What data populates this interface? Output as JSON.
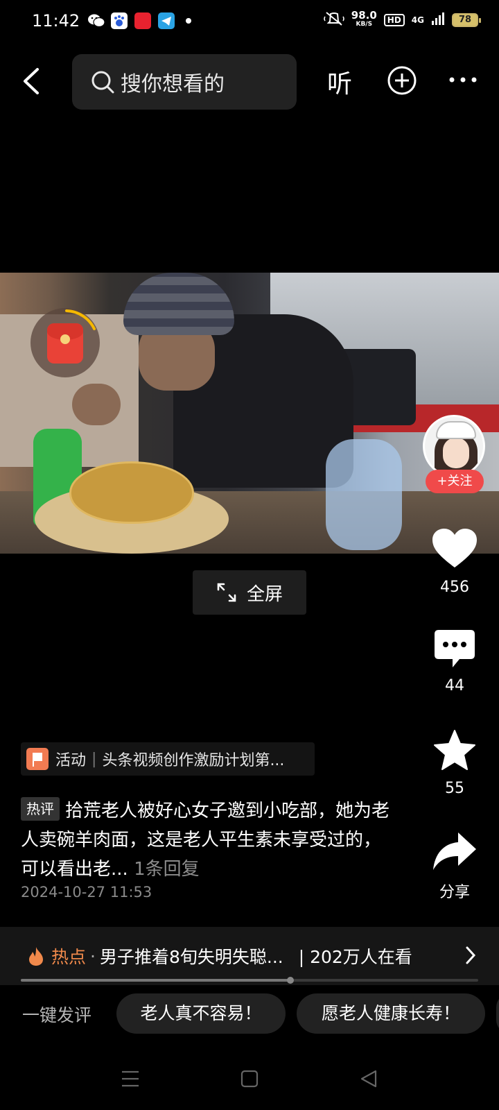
{
  "status_bar": {
    "time": "11:42",
    "app_icons": [
      "wechat-icon",
      "baidu-icon",
      "toutiao-icon",
      "telegram-icon"
    ],
    "net_speed": "98.0",
    "net_unit": "KB/S",
    "hd_label": "HD",
    "network_label": "4G",
    "battery": "78"
  },
  "top_nav": {
    "search_placeholder": "搜你想看的",
    "listen_label": "听"
  },
  "video": {
    "fullscreen_label": "全屏"
  },
  "author": {
    "follow_label": "+关注"
  },
  "actions": {
    "like_count": "456",
    "comment_count": "44",
    "favorite_count": "55",
    "share_label": "分享"
  },
  "activity": {
    "label": "活动",
    "text": "头条视频创作激励计划第..."
  },
  "hot_comment": {
    "badge": "热评",
    "text": "拾荒老人被好心女子邀到小吃部，她为老人卖碗羊肉面，这是老人平生素未享受过的，可以看出老...",
    "reply": "1条回复",
    "time": "2024-10-27 11:53"
  },
  "hotspot": {
    "label": "热点",
    "separator": "·",
    "title": "男子推着8旬失明失聪...",
    "viewers": "| 202万人在看",
    "progress": 0.59
  },
  "quick_comments": {
    "label": "一键发评",
    "chips": [
      "老人真不容易！",
      "愿老人健康长寿！"
    ]
  },
  "colors": {
    "background": "#000000",
    "follow_red": "#f04a4a",
    "hotspot_orange": "#f0894b"
  }
}
